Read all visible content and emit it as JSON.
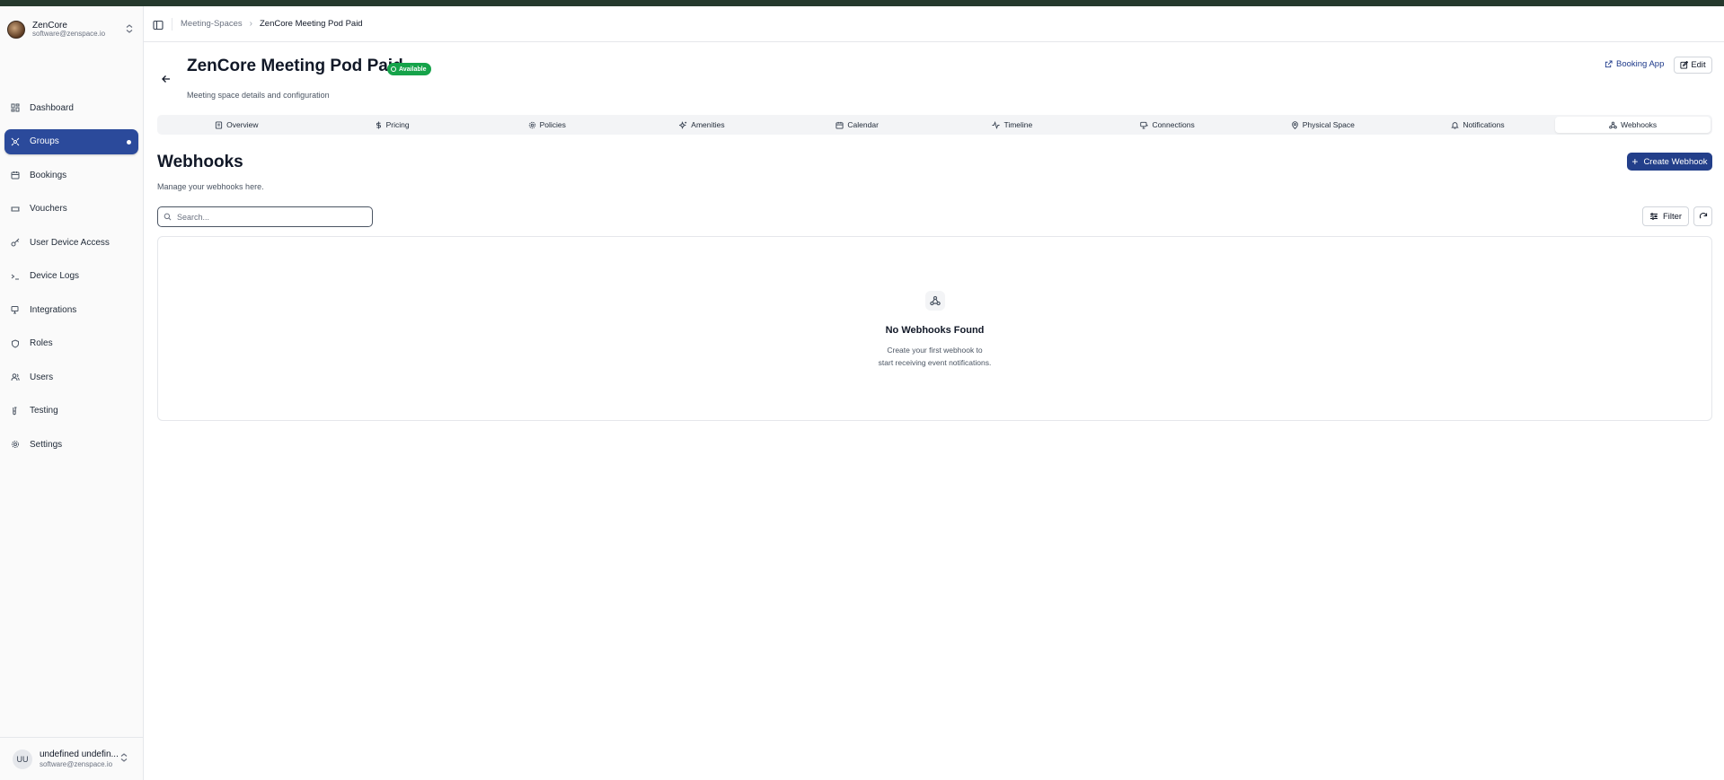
{
  "org": {
    "name": "ZenCore",
    "email": "software@zenspace.io"
  },
  "sidebar": {
    "items": [
      {
        "label": "Dashboard",
        "icon": "dashboard-icon"
      },
      {
        "label": "Groups",
        "icon": "groups-icon",
        "active": true
      },
      {
        "label": "Bookings",
        "icon": "calendar-icon"
      },
      {
        "label": "Vouchers",
        "icon": "ticket-icon"
      },
      {
        "label": "User Device Access",
        "icon": "key-icon"
      },
      {
        "label": "Device Logs",
        "icon": "terminal-icon"
      },
      {
        "label": "Integrations",
        "icon": "integrations-icon"
      },
      {
        "label": "Roles",
        "icon": "shield-icon"
      },
      {
        "label": "Users",
        "icon": "users-icon"
      },
      {
        "label": "Testing",
        "icon": "test-tube-icon"
      },
      {
        "label": "Settings",
        "icon": "gear-icon"
      }
    ]
  },
  "user": {
    "initials": "UU",
    "name": "undefined undefin...",
    "email": "software@zenspace.io"
  },
  "breadcrumb": {
    "parent": "Meeting-Spaces",
    "current": "ZenCore Meeting Pod Paid"
  },
  "page": {
    "title": "ZenCore Meeting Pod Paid",
    "status": "Available",
    "subtitle": "Meeting space details and configuration",
    "booking_app_label": "Booking App",
    "edit_label": "Edit"
  },
  "tabs": [
    {
      "label": "Overview",
      "icon": "overview-icon"
    },
    {
      "label": "Pricing",
      "icon": "dollar-icon"
    },
    {
      "label": "Policies",
      "icon": "gear-icon"
    },
    {
      "label": "Amenities",
      "icon": "sparkles-icon"
    },
    {
      "label": "Calendar",
      "icon": "calendar-icon"
    },
    {
      "label": "Timeline",
      "icon": "activity-icon"
    },
    {
      "label": "Connections",
      "icon": "connections-icon"
    },
    {
      "label": "Physical Space",
      "icon": "map-pin-icon"
    },
    {
      "label": "Notifications",
      "icon": "bell-icon"
    },
    {
      "label": "Webhooks",
      "icon": "webhook-icon",
      "active": true
    }
  ],
  "webhooks": {
    "title": "Webhooks",
    "subtitle": "Manage your webhooks here.",
    "create_label": "Create Webhook",
    "search_placeholder": "Search...",
    "filter_label": "Filter",
    "empty_title": "No Webhooks Found",
    "empty_line1": "Create your first webhook to",
    "empty_line2": "start receiving event notifications."
  },
  "colors": {
    "accent": "#233f8a",
    "active_nav": "#2b4a9b",
    "status_green": "#16a34a",
    "top_strip": "#25392d"
  }
}
